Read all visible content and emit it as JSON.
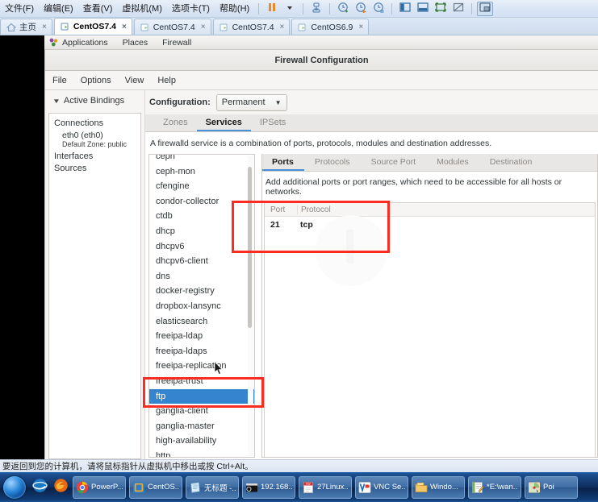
{
  "vmware": {
    "menus": [
      "文件(F)",
      "编辑(E)",
      "查看(V)",
      "虚拟机(M)",
      "选项卡(T)",
      "帮助(H)"
    ],
    "toolbar_icons": [
      "pause-icon",
      "dropdown-caret-icon",
      "snapshot-manager-icon",
      "take-snapshot-icon",
      "revert-snapshot-icon",
      "manage-snapshots-icon",
      "show-library-icon",
      "show-thumbnails-icon",
      "fullscreen-icon",
      "unity-mode-icon",
      "console-view-icon"
    ],
    "tabs": [
      {
        "label": "主页",
        "icon": "home-icon",
        "active": false
      },
      {
        "label": "CentOS7.4",
        "icon": "vm-icon",
        "active": true
      },
      {
        "label": "CentOS7.4",
        "icon": "vm-icon",
        "active": false
      },
      {
        "label": "CentOS7.4",
        "icon": "vm-icon",
        "active": false
      },
      {
        "label": "CentOS6.9",
        "icon": "vm-icon",
        "active": false
      }
    ],
    "close_glyph": "×"
  },
  "gnome": {
    "applications": "Applications",
    "places": "Places",
    "app_name": "Firewall"
  },
  "firewall": {
    "title": "Firewall Configuration",
    "menus": [
      "File",
      "Options",
      "View",
      "Help"
    ],
    "left": {
      "bindings_label": "Active Bindings",
      "connections_label": "Connections",
      "connection_name": "eth0 (eth0)",
      "connection_zone": "Default Zone: public",
      "interfaces_label": "Interfaces",
      "sources_label": "Sources"
    },
    "configuration_label": "Configuration:",
    "configuration_value": "Permanent",
    "zone_tabs": [
      {
        "label": "Zones",
        "active": false
      },
      {
        "label": "Services",
        "active": true
      },
      {
        "label": "IPSets",
        "active": false
      }
    ],
    "description": "A firewalld service is a combination of ports, protocols, modules and destination addresses.",
    "services": [
      {
        "name": "ceph",
        "selected": false
      },
      {
        "name": "ceph-mon",
        "selected": false
      },
      {
        "name": "cfengine",
        "selected": false
      },
      {
        "name": "condor-collector",
        "selected": false
      },
      {
        "name": "ctdb",
        "selected": false
      },
      {
        "name": "dhcp",
        "selected": false
      },
      {
        "name": "dhcpv6",
        "selected": false
      },
      {
        "name": "dhcpv6-client",
        "selected": false
      },
      {
        "name": "dns",
        "selected": false
      },
      {
        "name": "docker-registry",
        "selected": false
      },
      {
        "name": "dropbox-lansync",
        "selected": false
      },
      {
        "name": "elasticsearch",
        "selected": false
      },
      {
        "name": "freeipa-ldap",
        "selected": false
      },
      {
        "name": "freeipa-ldaps",
        "selected": false
      },
      {
        "name": "freeipa-replication",
        "selected": false
      },
      {
        "name": "freeipa-trust",
        "selected": false
      },
      {
        "name": "ftp",
        "selected": true
      },
      {
        "name": "ganglia-client",
        "selected": false
      },
      {
        "name": "ganglia-master",
        "selected": false
      },
      {
        "name": "high-availability",
        "selected": false
      },
      {
        "name": "http",
        "selected": false
      }
    ],
    "detail_tabs": [
      {
        "label": "Ports",
        "active": true
      },
      {
        "label": "Protocols",
        "active": false
      },
      {
        "label": "Source Port",
        "active": false
      },
      {
        "label": "Modules",
        "active": false
      },
      {
        "label": "Destination",
        "active": false
      }
    ],
    "ports_description": "Add additional ports or port ranges, which need to be accessible for all hosts or networks.",
    "ports_table": {
      "columns": [
        "Port",
        "Protocol"
      ],
      "rows": [
        [
          "21",
          "tcp"
        ]
      ]
    }
  },
  "annotations": {
    "accent_color": "#fb2c22",
    "boxes": [
      "ports-table-highlight",
      "ftp-service-highlight"
    ]
  },
  "windows": {
    "status_text": "要返回到您的计算机，请将鼠标指针从虚拟机中移出或按 Ctrl+Alt。",
    "taskbar": [
      {
        "label": "PowerP...",
        "icon": "chrome-icon"
      },
      {
        "label": "CentOS...",
        "icon": "vmware-icon"
      },
      {
        "label": "无标题 -...",
        "icon": "notepad-icon"
      },
      {
        "label": "192.168...",
        "icon": "terminal-icon"
      },
      {
        "label": "27Linux...",
        "icon": "pdf-icon"
      },
      {
        "label": "VNC Se...",
        "icon": "vnc-icon"
      },
      {
        "label": "Windo...",
        "icon": "folder-icon"
      },
      {
        "label": "*E:\\wan...",
        "icon": "editor-icon"
      },
      {
        "label": "Poi",
        "icon": "powerpoint-icon"
      }
    ],
    "quicklaunch": [
      "ie-icon",
      "firefox-icon"
    ]
  }
}
